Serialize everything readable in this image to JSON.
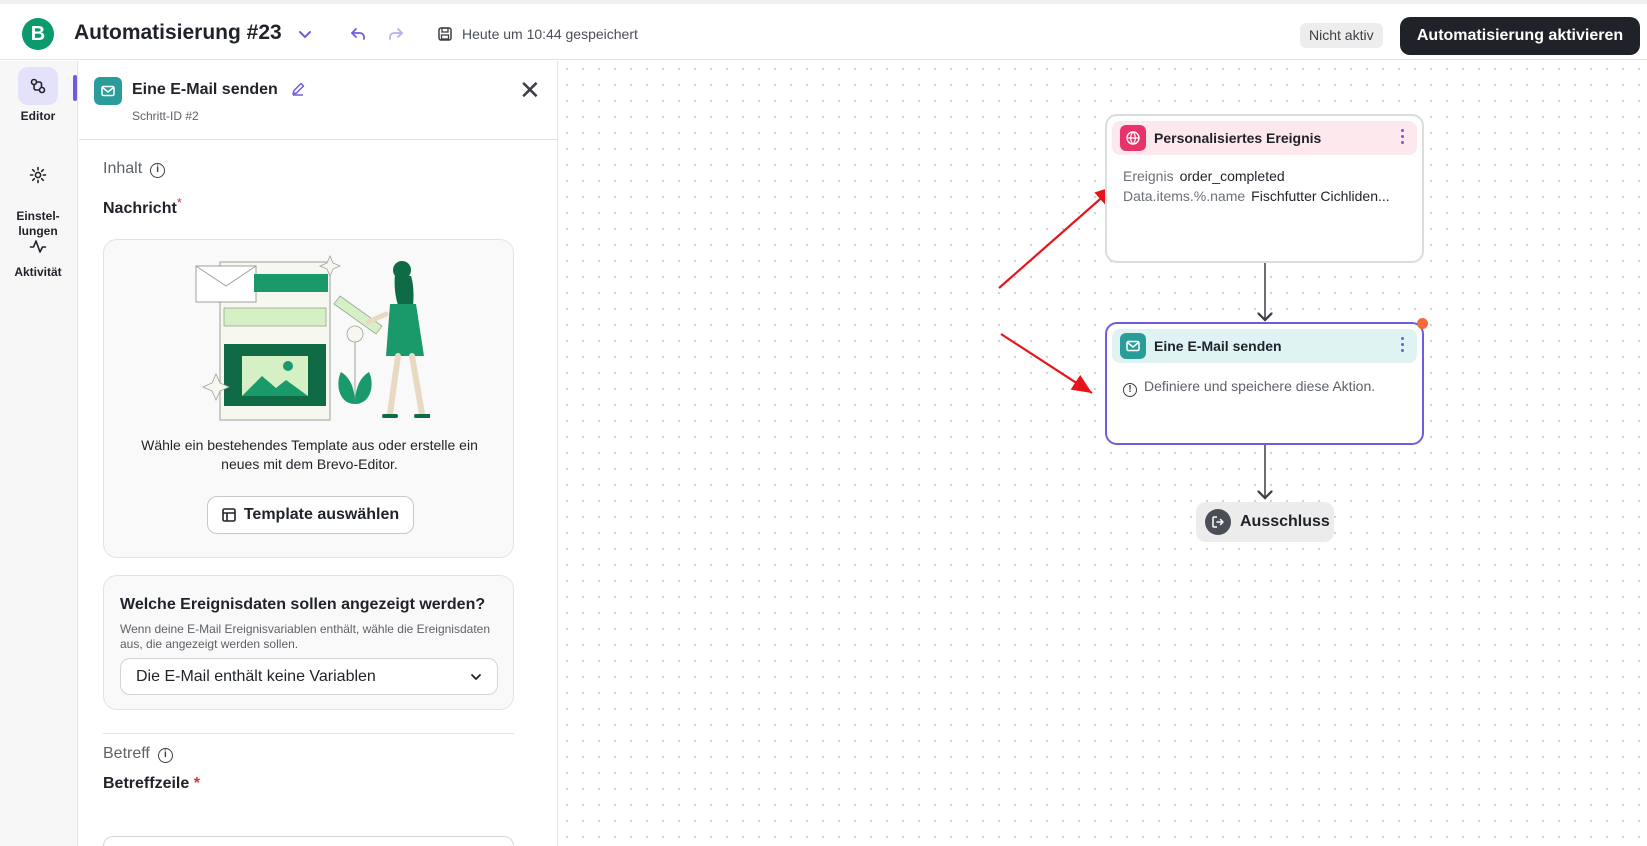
{
  "header": {
    "logo_letter": "B",
    "title": "Automatisierung #23",
    "saved_text": "Heute um 10:44 gespeichert",
    "status_badge": "Nicht aktiv",
    "activate_button": "Automatisierung aktivieren"
  },
  "rail": {
    "items": [
      {
        "label": "Editor",
        "icon": "editor-icon",
        "active": true
      },
      {
        "label": "Einstel-\nlungen",
        "icon": "gear-icon",
        "active": false
      },
      {
        "label": "Aktivität",
        "icon": "activity-icon",
        "active": false
      }
    ]
  },
  "panel": {
    "title": "Eine E-Mail senden",
    "step_id": "Schritt-ID #2",
    "section_content": "Inhalt",
    "message_label": "Nachricht",
    "required_mark": "*",
    "template_text": "Wähle ein bestehendes Template aus oder erstelle ein neues mit dem Brevo-Editor.",
    "template_button": "Template auswählen",
    "event_question": "Welche Ereignisdaten sollen angezeigt werden?",
    "event_help": "Wenn deine E-Mail Ereignisvariablen enthält, wähle die Ereignisdaten aus, die angezeigt werden sollen.",
    "event_select_value": "Die E-Mail enthält keine Variablen",
    "section_subject": "Betreff",
    "subject_label": "Betreffzeile",
    "subject_required": "*"
  },
  "canvas": {
    "trigger_node": {
      "title": "Personalisiertes Ereignis",
      "rows": [
        {
          "key": "Ereignis",
          "value": "order_completed"
        },
        {
          "key": "Data.items.%.name",
          "value": "Fischfutter Cichliden..."
        }
      ]
    },
    "action_node": {
      "title": "Eine E-Mail senden",
      "warning": "Definiere und speichere diese Aktion."
    },
    "exit_node": {
      "label": "Ausschluss"
    }
  },
  "colors": {
    "brand": "#0b996e",
    "accent": "#6f5ce0",
    "dark_button": "#1f2329",
    "trigger_head": "#fde8ee",
    "trigger_icon": "#e8336a",
    "action_head": "#dff3f2",
    "action_icon": "#2a9d9a",
    "alert_dot": "#f26b3a",
    "annotation_arrow": "#e8141b"
  }
}
